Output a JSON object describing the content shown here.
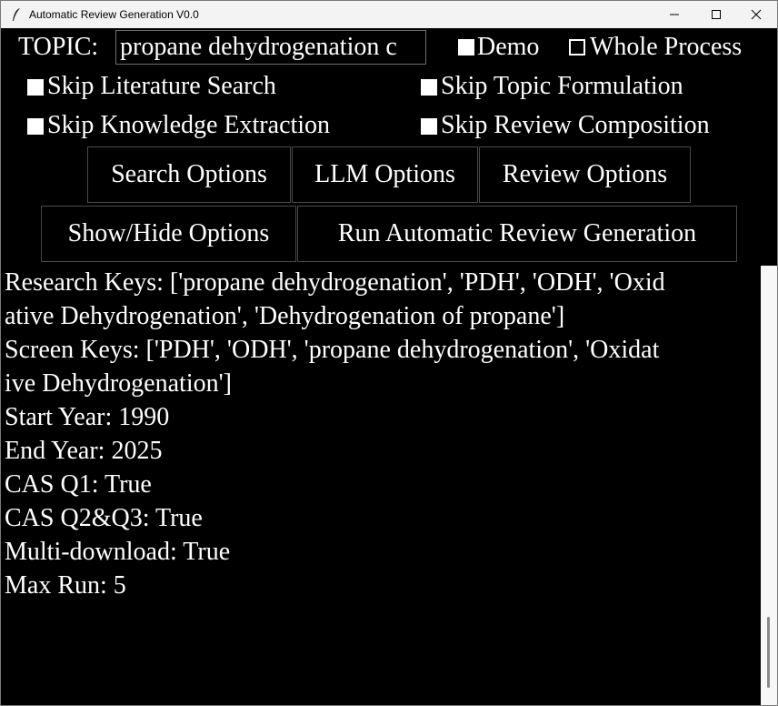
{
  "window": {
    "title": "Automatic Review Generation V0.0",
    "icons": {
      "app": "feather-icon",
      "minimize": "minimize-icon",
      "maximize": "maximize-icon",
      "close": "close-icon"
    }
  },
  "controls": {
    "topic_label": "TOPIC:",
    "topic_value": "propane dehydrogenation c",
    "checkboxes": {
      "demo": {
        "label": "Demo",
        "checked": true
      },
      "whole_process": {
        "label": "Whole Process",
        "checked": false
      },
      "skip_literature_search": {
        "label": "Skip Literature Search",
        "checked": true
      },
      "skip_topic_formulation": {
        "label": "Skip Topic Formulation",
        "checked": true
      },
      "skip_knowledge_extraction": {
        "label": "Skip Knowledge Extraction",
        "checked": true
      },
      "skip_review_composition": {
        "label": "Skip Review Composition",
        "checked": true
      }
    },
    "buttons": {
      "search_options": "Search Options",
      "llm_options": "LLM Options",
      "review_options": "Review Options",
      "show_hide_options": "Show/Hide Options",
      "run": "Run Automatic Review Generation"
    }
  },
  "log": {
    "lines": [
      "Research Keys: ['propane dehydrogenation', 'PDH', 'ODH', 'Oxid",
      "ative Dehydrogenation', 'Dehydrogenation of propane']",
      "Screen Keys: ['PDH', 'ODH', 'propane dehydrogenation', 'Oxidat",
      "ive Dehydrogenation']",
      "Start Year: 1990",
      "End Year: 2025",
      "CAS Q1: True",
      "CAS Q2&Q3: True",
      "Multi-download: True",
      "Max Run: 5"
    ]
  },
  "colors": {
    "background": "#000000",
    "text": "#ffffff",
    "titlebar": "#f3f3f3",
    "scrollbar": "#f7f7f7"
  }
}
